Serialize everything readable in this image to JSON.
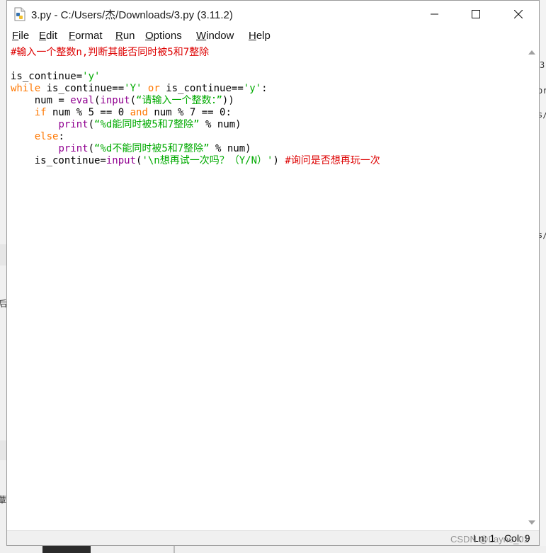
{
  "window": {
    "title": "3.py - C:/Users/杰/Downloads/3.py (3.11.2)"
  },
  "menu": [
    {
      "label": "File",
      "mnemonic_index": 0
    },
    {
      "label": "Edit",
      "mnemonic_index": 0
    },
    {
      "label": "Format",
      "mnemonic_index": 0
    },
    {
      "label": "Run",
      "mnemonic_index": 0
    },
    {
      "label": "Options",
      "mnemonic_index": 0
    },
    {
      "label": "Window",
      "mnemonic_index": 0
    },
    {
      "label": "Help",
      "mnemonic_index": 0
    }
  ],
  "editor": {
    "lines": [
      [
        {
          "t": "#输入一个整数n,判断其能否同时被5和7整除",
          "c": "cm"
        }
      ],
      [],
      [
        {
          "t": "is_continue="
        },
        {
          "t": "'y'",
          "c": "st"
        }
      ],
      [
        {
          "t": "while",
          "c": "kw"
        },
        {
          "t": " is_continue=="
        },
        {
          "t": "'Y'",
          "c": "st"
        },
        {
          "t": " "
        },
        {
          "t": "or",
          "c": "kw"
        },
        {
          "t": " is_continue=="
        },
        {
          "t": "'y'",
          "c": "st"
        },
        {
          "t": ":"
        }
      ],
      [
        {
          "t": "    num = "
        },
        {
          "t": "eval",
          "c": "bi"
        },
        {
          "t": "("
        },
        {
          "t": "input",
          "c": "bi"
        },
        {
          "t": "("
        },
        {
          "t": "“请输入一个整数：”",
          "c": "st"
        },
        {
          "t": "))"
        }
      ],
      [
        {
          "t": "    "
        },
        {
          "t": "if",
          "c": "kw"
        },
        {
          "t": " num % 5 == 0 "
        },
        {
          "t": "and",
          "c": "kw"
        },
        {
          "t": " num % 7 == 0:"
        }
      ],
      [
        {
          "t": "        "
        },
        {
          "t": "print",
          "c": "bi"
        },
        {
          "t": "("
        },
        {
          "t": "“%d能同时被5和7整除”",
          "c": "st"
        },
        {
          "t": " % num)"
        }
      ],
      [
        {
          "t": "    "
        },
        {
          "t": "else",
          "c": "kw"
        },
        {
          "t": ":"
        }
      ],
      [
        {
          "t": "        "
        },
        {
          "t": "print",
          "c": "bi"
        },
        {
          "t": "("
        },
        {
          "t": "“%d不能同时被5和7整除”",
          "c": "st"
        },
        {
          "t": " % num)"
        }
      ],
      [
        {
          "t": "    is_continue="
        },
        {
          "t": "input",
          "c": "bi"
        },
        {
          "t": "("
        },
        {
          "t": "'\\n想再试一次吗？（Y/N）'",
          "c": "st"
        },
        {
          "t": ") "
        },
        {
          "t": "#询问是否想再玩一次",
          "c": "cm"
        }
      ]
    ]
  },
  "status": {
    "line": "Ln: 1",
    "col": "Col: 9"
  },
  "watermark": "CSDN @Layne_01",
  "background_fragments": {
    "right": [
      "3",
      "or",
      "s/",
      "s/"
    ],
    "left": [
      "后",
      "蕈"
    ]
  },
  "colors": {
    "keyword": "#ff7700",
    "builtin": "#900090",
    "string": "#00aa00",
    "comment": "#dd0000",
    "text": "#000000"
  },
  "icons": {
    "app": "python-file-icon",
    "minimize": "minimize-icon",
    "maximize": "maximize-icon",
    "close": "close-icon"
  }
}
